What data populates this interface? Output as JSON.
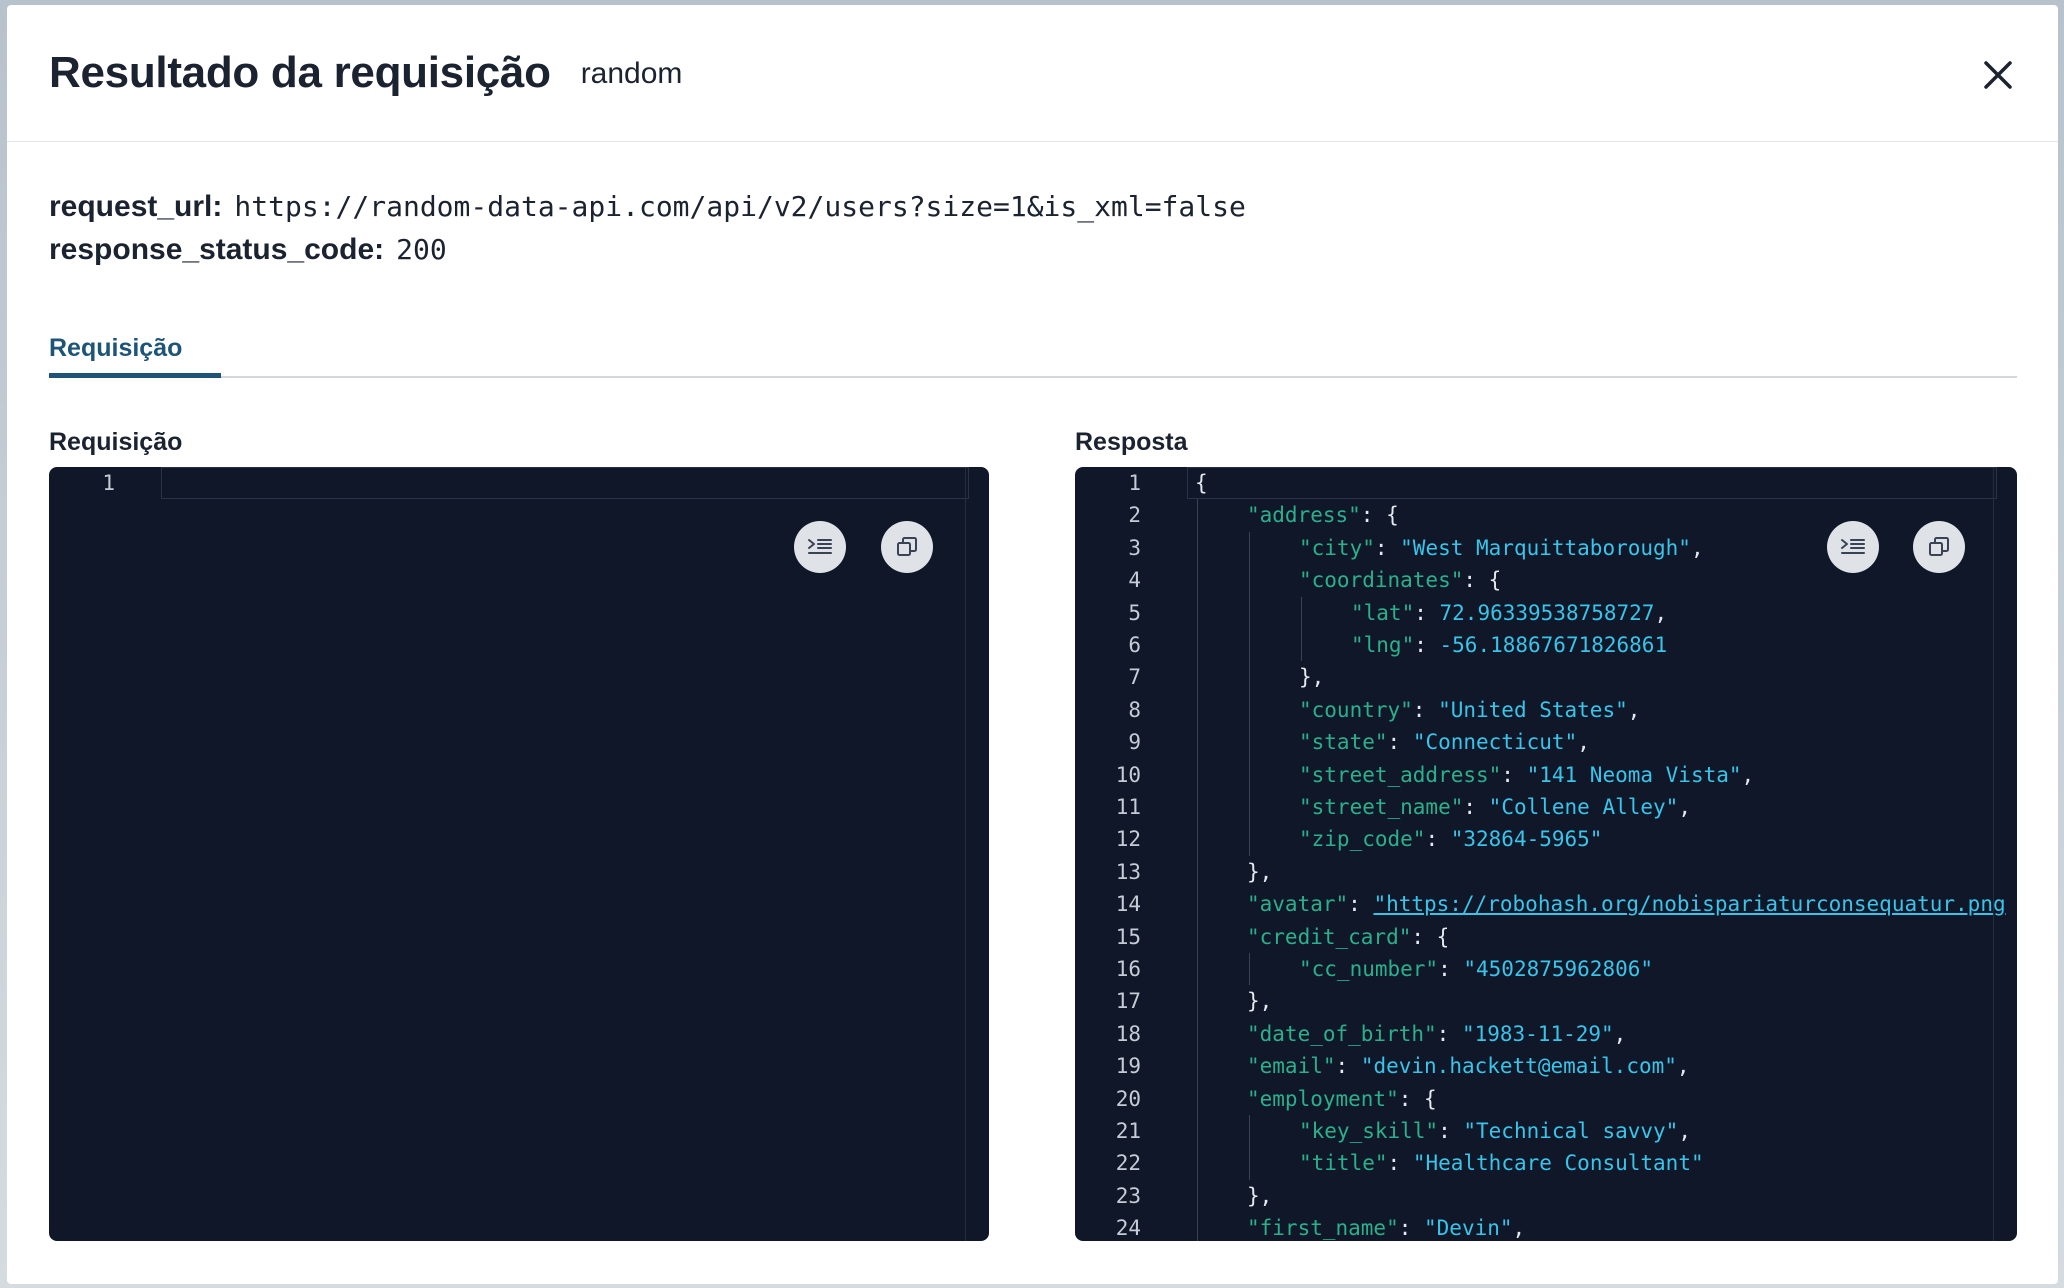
{
  "modal": {
    "title": "Resultado da requisição",
    "subtitle": "random"
  },
  "info": {
    "request_url_key": "request_url:",
    "request_url_val": "https://random-data-api.com/api/v2/users?size=1&is_xml=false",
    "status_key": "response_status_code:",
    "status_val": "200"
  },
  "tabs": [
    {
      "label": "Requisição",
      "active": true
    }
  ],
  "request_panel": {
    "label": "Requisição",
    "line_numbers": [
      "1"
    ]
  },
  "response_panel": {
    "label": "Resposta",
    "line_numbers": [
      "1",
      "2",
      "3",
      "4",
      "5",
      "6",
      "7",
      "8",
      "9",
      "10",
      "11",
      "12",
      "13",
      "14",
      "15",
      "16",
      "17",
      "18",
      "19",
      "20",
      "21",
      "22",
      "23",
      "24"
    ],
    "lines": [
      {
        "indent": 0,
        "text": "{"
      },
      {
        "indent": 1,
        "key": "\"address\"",
        "rest": ": {"
      },
      {
        "indent": 2,
        "key": "\"city\"",
        "val": "\"West Marquittaborough\"",
        "tail": ","
      },
      {
        "indent": 2,
        "key": "\"coordinates\"",
        "rest": ": {"
      },
      {
        "indent": 3,
        "key": "\"lat\"",
        "val": "72.96339538758727",
        "tail": ","
      },
      {
        "indent": 3,
        "key": "\"lng\"",
        "val": "-56.18867671826861",
        "tail": ""
      },
      {
        "indent": 2,
        "text": "},"
      },
      {
        "indent": 2,
        "key": "\"country\"",
        "val": "\"United States\"",
        "tail": ","
      },
      {
        "indent": 2,
        "key": "\"state\"",
        "val": "\"Connecticut\"",
        "tail": ","
      },
      {
        "indent": 2,
        "key": "\"street_address\"",
        "val": "\"141 Neoma Vista\"",
        "tail": ","
      },
      {
        "indent": 2,
        "key": "\"street_name\"",
        "val": "\"Collene Alley\"",
        "tail": ","
      },
      {
        "indent": 2,
        "key": "\"zip_code\"",
        "val": "\"32864-5965\"",
        "tail": ""
      },
      {
        "indent": 1,
        "text": "},"
      },
      {
        "indent": 1,
        "key": "\"avatar\"",
        "link": "\"https://robohash.org/nobispariaturconsequatur.png",
        "tail": ""
      },
      {
        "indent": 1,
        "key": "\"credit_card\"",
        "rest": ": {"
      },
      {
        "indent": 2,
        "key": "\"cc_number\"",
        "val": "\"4502875962806\"",
        "tail": ""
      },
      {
        "indent": 1,
        "text": "},"
      },
      {
        "indent": 1,
        "key": "\"date_of_birth\"",
        "val": "\"1983-11-29\"",
        "tail": ","
      },
      {
        "indent": 1,
        "key": "\"email\"",
        "val": "\"devin.hackett@email.com\"",
        "tail": ","
      },
      {
        "indent": 1,
        "key": "\"employment\"",
        "rest": ": {"
      },
      {
        "indent": 2,
        "key": "\"key_skill\"",
        "val": "\"Technical savvy\"",
        "tail": ","
      },
      {
        "indent": 2,
        "key": "\"title\"",
        "val": "\"Healthcare Consultant\"",
        "tail": ""
      },
      {
        "indent": 1,
        "text": "},"
      },
      {
        "indent": 1,
        "key": "\"first_name\"",
        "val": "\"Devin\"",
        "tail": ","
      }
    ]
  },
  "icons": {
    "close": "close-icon",
    "format": "format-icon",
    "copy": "copy-icon"
  },
  "colors": {
    "editor_bg": "#0f1729",
    "json_key": "#2bb08c",
    "json_value": "#39c4e9",
    "tab_active": "#1d5477"
  }
}
